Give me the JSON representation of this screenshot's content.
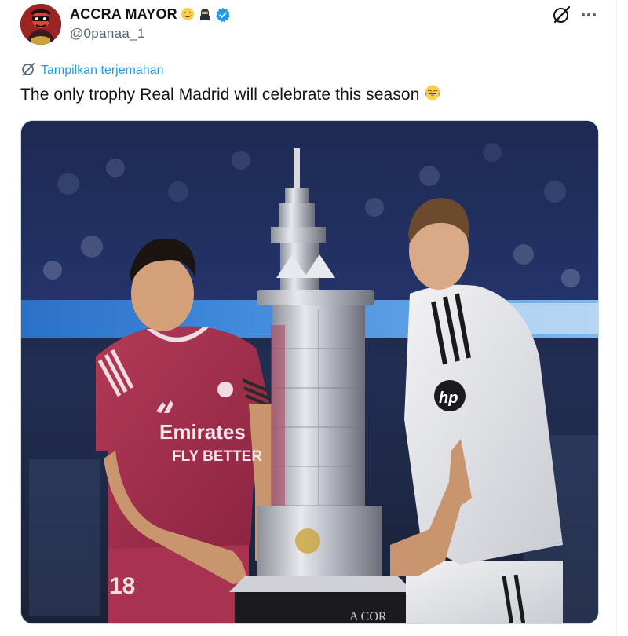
{
  "author": {
    "display_name": "ACCRA MAYOR",
    "handle": "@0panaa_1",
    "name_emojis": [
      "smiling-face-with-tear-emoji",
      "ninja-emoji"
    ],
    "verified": true
  },
  "actions": {
    "grok_icon": "grok-icon",
    "more_icon": "more-icon"
  },
  "translate": {
    "label": "Tampilkan terjemahan"
  },
  "tweet": {
    "text": "The only trophy Real Madrid will celebrate this season",
    "text_emoji": "face-with-tears-of-joy-emoji"
  },
  "media": {
    "kind": "photo",
    "visible_text": {
      "left_shirt_sponsor_line1": "Emirates",
      "left_shirt_sponsor_line2": "FLY BETTER",
      "left_shorts_number": "18",
      "right_shirt_logo": "hp",
      "trophy_base_text": "A COR"
    }
  },
  "colors": {
    "link_blue": "#1d9bf0",
    "verified_blue": "#1d9bf0",
    "secondary_text": "#536471",
    "primary_text": "#0f1419",
    "border": "#cfd9de"
  }
}
